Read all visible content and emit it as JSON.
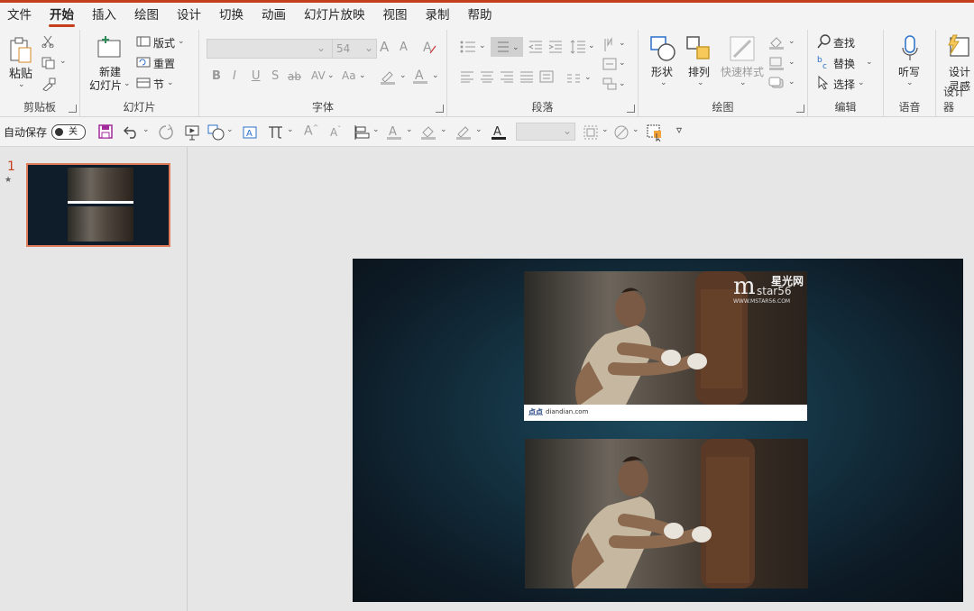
{
  "menu": {
    "tabs": [
      "文件",
      "开始",
      "插入",
      "绘图",
      "设计",
      "切换",
      "动画",
      "幻灯片放映",
      "视图",
      "录制",
      "帮助"
    ],
    "active": "开始"
  },
  "ribbon": {
    "clipboard": {
      "group": "剪贴板",
      "paste": "粘贴"
    },
    "slides": {
      "group": "幻灯片",
      "new_slide_1": "新建",
      "new_slide_2": "幻灯片",
      "layout": "版式",
      "reset": "重置",
      "section": "节"
    },
    "font": {
      "group": "字体",
      "size": "54",
      "bold": "B",
      "italic": "I",
      "underline": "U",
      "shadow": "S",
      "strike": "ab",
      "spacing": "AV",
      "case": "Aa",
      "grow": "A",
      "shrink": "A"
    },
    "paragraph": {
      "group": "段落"
    },
    "drawing": {
      "group": "绘图",
      "shapes": "形状",
      "arrange": "排列",
      "quick_styles": "快速样式"
    },
    "editing": {
      "group": "编辑",
      "find": "查找",
      "replace": "替换",
      "select": "选择"
    },
    "voice": {
      "group": "语音",
      "dictate": "听写"
    },
    "designer": {
      "group": "设计器",
      "designer_1": "设计",
      "designer_2": "灵感"
    }
  },
  "qat": {
    "autosave": "自动保存",
    "toggle": "关"
  },
  "slides_pane": {
    "number": "1",
    "star": "★"
  },
  "slide": {
    "top_photo_caption": "diandian.com",
    "top_photo_caption_mark": "点点",
    "watermark_line1": "星光网",
    "watermark_line2": "star56",
    "watermark_line3": "WWW.MSTAR56.COM"
  },
  "colors": {
    "accent": "#c43e1c",
    "ribbon_bg": "#f3f3f3",
    "slide_bg": "#0d1b26"
  }
}
